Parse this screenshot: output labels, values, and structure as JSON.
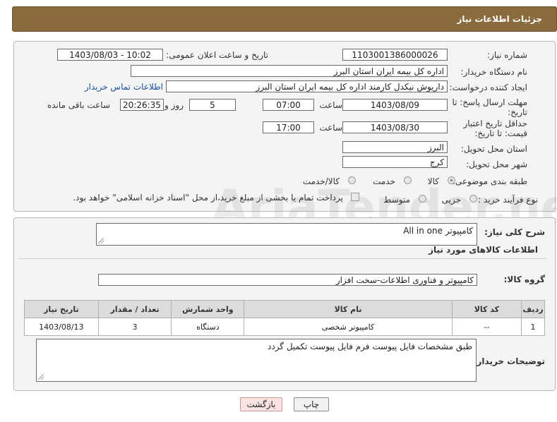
{
  "header": {
    "title": "جزئیات اطلاعات نیاز"
  },
  "watermark": "AriaTender.neT",
  "fields": {
    "need_number_label": "شماره نیاز:",
    "need_number": "1103001386000026",
    "announce_label": "تاریخ و ساعت اعلان عمومی:",
    "announce_value": "1403/08/03 - 10:02",
    "buyer_org_label": "نام دستگاه خریدار:",
    "buyer_org": "اداره کل بیمه ایران استان البرز",
    "creator_label": "ایجاد کننده درخواست:",
    "creator": "داریوش  نیکدل کارمند  اداره کل بیمه ایران استان البرز",
    "buyer_contact_link": "اطلاعات تماس خریدار",
    "reply_deadline_label": "مهلت ارسال پاسخ: تا تاریخ:",
    "reply_date": "1403/08/09",
    "time_label": "ساعت",
    "reply_time": "07:00",
    "days_value": "5",
    "days_label": "روز و",
    "remaining_time": "20:26:35",
    "remaining_label": "ساعت باقی مانده",
    "price_validity_label": "حداقل تاریخ اعتبار قیمت: تا تاریخ:",
    "validity_date": "1403/08/30",
    "validity_time": "17:00",
    "province_label": "استان محل تحویل:",
    "province": "البرز",
    "city_label": "شهر محل تحویل:",
    "city": "کرج",
    "category_label": "طبقه بندی موضوعی:",
    "category_options": [
      "کالا",
      "خدمت",
      "کالا/خدمت"
    ],
    "process_label": "نوع فرآیند خرید :",
    "process_options": [
      "جزیی",
      "متوسط"
    ],
    "payment_note": "پرداخت تمام یا بخشی از مبلغ خرید،از محل \"اسناد خزانه اسلامی\" خواهد بود."
  },
  "section2": {
    "general_desc_label": "شرح کلی نیاز:",
    "general_desc": "کامپیوتر All in one",
    "goods_info_title": "اطلاعات کالاهای مورد نیاز",
    "goods_group_label": "گروه کالا:",
    "goods_group": "کامپیوتر و فناوری اطلاعات-سخت افزار",
    "table": {
      "headers": [
        "ردیف",
        "کد کالا",
        "نام کالا",
        "واحد شمارش",
        "تعداد / مقدار",
        "تاریخ نیاز"
      ],
      "rows": [
        [
          "1",
          "--",
          "کامپیوتر شخصی",
          "دستگاه",
          "3",
          "1403/08/13"
        ]
      ]
    },
    "buyer_notes_label": "توضیحات خریدار:",
    "buyer_notes": "طبق مشخصات فایل پیوست فرم فایل پیوست تکمیل گردد"
  },
  "buttons": {
    "print": "چاپ",
    "back": "بازگشت"
  }
}
